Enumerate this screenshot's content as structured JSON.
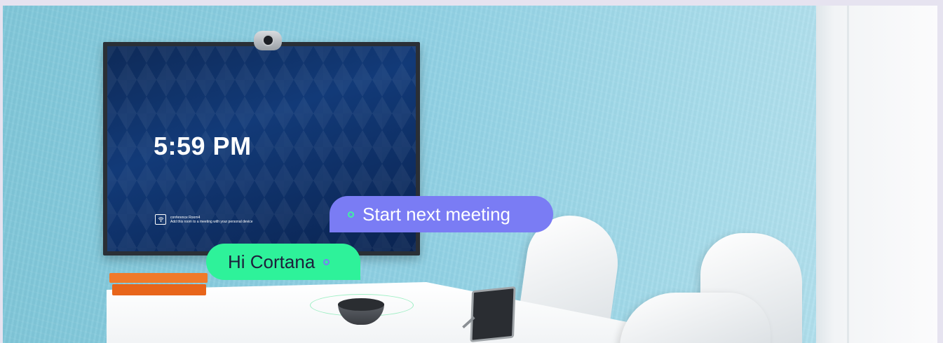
{
  "tv": {
    "time": "5:59 PM",
    "room_name": "conference Room4",
    "room_hint": "Add this room to a meeting with your personal device"
  },
  "bubbles": {
    "start_meeting": "Start next meeting",
    "hi_cortana": "Hi Cortana"
  },
  "colors": {
    "start_bubble": "#7a7cf4",
    "cortana_bubble": "#2ef29a",
    "wall": "#8fd0e3"
  }
}
